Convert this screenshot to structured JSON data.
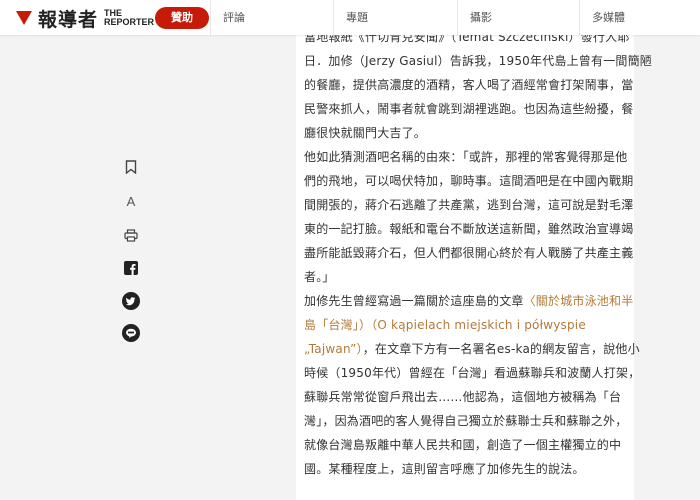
{
  "header": {
    "logo_cn": "報導者",
    "logo_en_1": "THE",
    "logo_en_2": "REPORTER",
    "donate_label": "贊助",
    "nav": [
      "評論",
      "專題",
      "攝影",
      "多媒體"
    ]
  },
  "toolbar": {
    "icons": [
      "bookmark-icon",
      "font-size-icon",
      "print-icon",
      "facebook-icon",
      "twitter-icon",
      "line-icon"
    ],
    "font_size_label": "A"
  },
  "article": {
    "lines": [
      "當地報紙《什切青克安聞》（Temat Szczeciński）發行人耶",
      "日．加修（Jerzy Gasiul）告訴我，1950年代島上曾有一間簡陋",
      "的餐廳，提供高濃度的酒精，客人喝了酒經常會打架鬧事，當",
      "民警來抓人，鬧事者就會跳到湖裡逃跑。也因為這些紛擾，餐",
      "廳很快就關門大吉了。",
      "他如此猜測酒吧名稱的由來：「或許，那裡的常客覺得那是他",
      "們的飛地，可以喝伏特加，聊時事。這間酒吧是在中國內戰期",
      "間開張的，蔣介石逃離了共產黨，逃到台灣，這可說是對毛澤",
      "東的一記打臉。報紙和電台不斷放送這新聞，雖然政治宣導竭",
      "盡所能詆毀蔣介石，但人們都很開心終於有人戰勝了共產主義",
      "者。」",
      "加修先生曾經寫過一篇關於這座島的文章",
      "島「台灣」）（O kąpielach miejskich i półwyspie",
      "„Tajwan”），在文章下方有一名署名es-ka的網友留言，說他小",
      "時候（1950年代）曾經在「台灣」看過蘇聯兵和波蘭人打架，",
      "蘇聯兵常常從窗戶飛出去……他認為，這個地方被稱為「台",
      "灣」，因為酒吧的客人覺得自己獨立於蘇聯士兵和蘇聯之外，",
      "就像台灣島叛離中華人民共和國，創造了一個主權獨立的中",
      "國。某種程度上，這則留言呼應了加修先生的說法。"
    ],
    "link_part_1": "〈關於城市泳池和半",
    "link_part_2": "島「台灣」）（O kąpielach miejskich i półwyspie",
    "link_part_3": "„Tajwan”）",
    "after_link": "，在文章下方有一名署名es-ka的網友留言，說他小"
  },
  "colors": {
    "brand_red": "#c71b0a",
    "link_gold": "#b27a3a"
  }
}
